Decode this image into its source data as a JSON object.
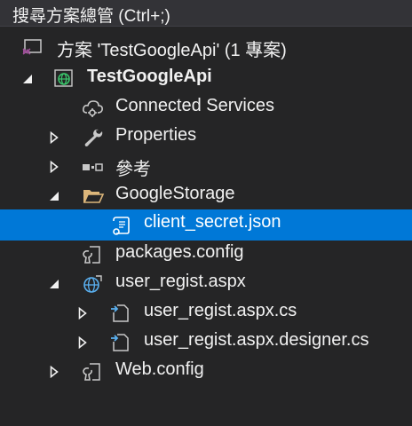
{
  "search": {
    "placeholder": "搜尋方案總管 (Ctrl+;)"
  },
  "solution": {
    "label": "方案 'TestGoogleApi' (1 專案)"
  },
  "project": {
    "label": "TestGoogleApi"
  },
  "items": {
    "connected_services": "Connected Services",
    "properties": "Properties",
    "references": "參考",
    "google_storage": "GoogleStorage",
    "client_secret": "client_secret.json",
    "packages_config": "packages.config",
    "user_regist": "user_regist.aspx",
    "user_regist_cs": "user_regist.aspx.cs",
    "user_regist_designer": "user_regist.aspx.designer.cs",
    "web_config": "Web.config"
  },
  "colors": {
    "background": "#252526",
    "selection": "#0078d7",
    "text": "#f1f1f1",
    "vs_purple": "#9b4f96",
    "globe_green": "#3ac96c",
    "folder_yellow": "#dcb67a",
    "link_blue": "#5ab0f0"
  }
}
